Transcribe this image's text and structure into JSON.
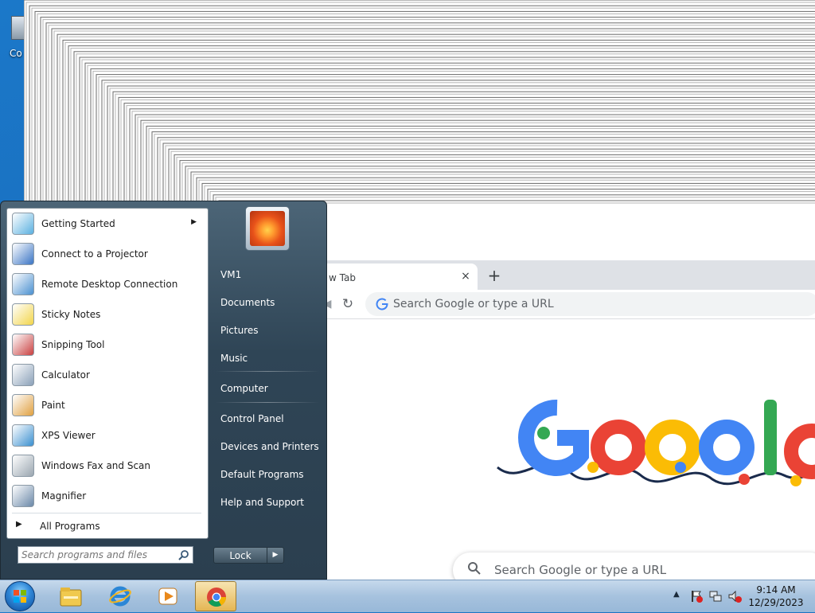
{
  "desktop": {
    "icon_label": "Co"
  },
  "chrome": {
    "tab_title": "w Tab",
    "tab_close": "×",
    "new_tab": "+",
    "omnibox_placeholder": "Search Google or type a URL",
    "ntp_search_placeholder": "Search Google or type a URL"
  },
  "start_menu": {
    "programs": [
      {
        "label": "Getting Started",
        "icon": "getting-started-icon",
        "has_submenu": true
      },
      {
        "label": "Connect to a Projector",
        "icon": "projector-icon"
      },
      {
        "label": "Remote Desktop Connection",
        "icon": "remote-desktop-icon"
      },
      {
        "label": "Sticky Notes",
        "icon": "sticky-notes-icon"
      },
      {
        "label": "Snipping Tool",
        "icon": "snipping-tool-icon"
      },
      {
        "label": "Calculator",
        "icon": "calculator-icon"
      },
      {
        "label": "Paint",
        "icon": "paint-icon"
      },
      {
        "label": "XPS Viewer",
        "icon": "xps-viewer-icon"
      },
      {
        "label": "Windows Fax and Scan",
        "icon": "fax-scan-icon"
      },
      {
        "label": "Magnifier",
        "icon": "magnifier-icon"
      }
    ],
    "all_programs": "All Programs",
    "search_placeholder": "Search programs and files",
    "right_items": [
      {
        "label": "VM1"
      },
      {
        "label": "Documents"
      },
      {
        "label": "Pictures"
      },
      {
        "label": "Music"
      },
      {
        "label": "Computer"
      },
      {
        "label": "Control Panel"
      },
      {
        "label": "Devices and Printers"
      },
      {
        "label": "Default Programs"
      },
      {
        "label": "Help and Support"
      }
    ],
    "lock_label": "Lock"
  },
  "taskbar": {
    "clock_time": "9:14 AM",
    "clock_date": "12/29/2023"
  },
  "colors": {
    "google_blue": "#4285f4",
    "google_red": "#ea4335",
    "google_yellow": "#fbbc05",
    "google_green": "#34a853"
  }
}
